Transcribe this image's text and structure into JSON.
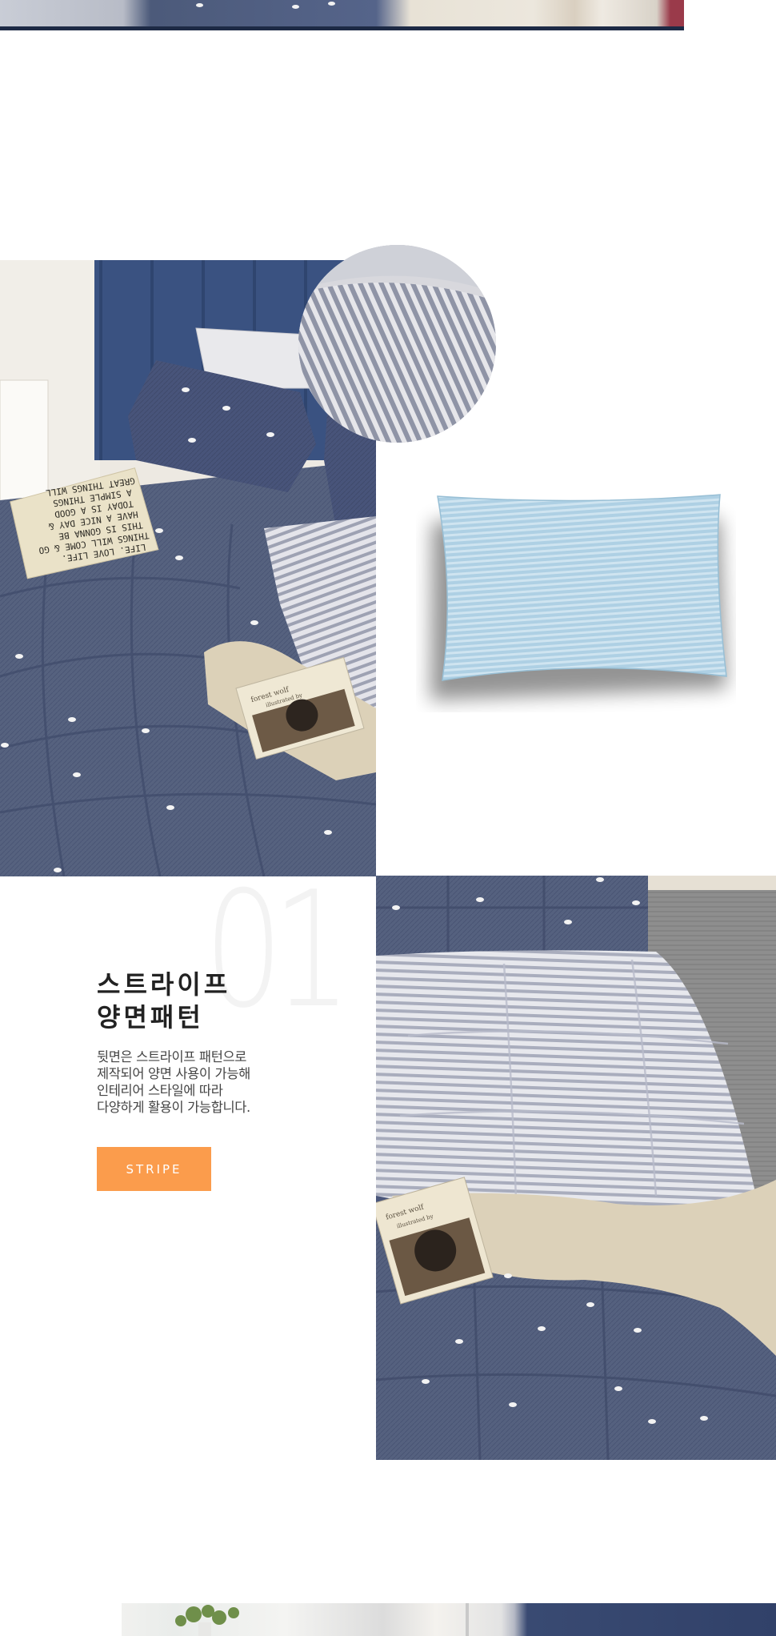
{
  "colors": {
    "accent": "#fb9c4c",
    "navy": "#1d2a45",
    "denim": "#4d5a7c",
    "title_text": "#222222",
    "body_text": "#444444",
    "watermark_number": "#f3f3f3",
    "pillow_blue": "#a9cde2"
  },
  "section": {
    "number": "01",
    "title_lines": [
      "스트라이프",
      "양면패턴"
    ],
    "description_lines": [
      "뒷면은 스트라이프 패턴으로",
      "제작되어 양면 사용이 가능해",
      "인테리어 스타일에 따라",
      "다양하게 활용이 가능합니다."
    ],
    "button_label": "STRIPE"
  },
  "photos": {
    "main": "bedding-set-bedroom",
    "detail": "stripe-reverse-closeup",
    "pillow": "blue-stripe-pillow",
    "folded": "folded-reversible-comforter"
  },
  "book_cover_text": [
    "forest wolf",
    "illustrated by"
  ],
  "cushion_text_lines": [
    "LIFE. LOVE LIFE.",
    "THINGS WILL COME & GO",
    "THIS IS GONNA BE",
    "HAVE A NICE DAY &",
    "TODAY IS A GOOD",
    "A SIMPLE THINGS",
    "GREAT THINGS WILL"
  ]
}
